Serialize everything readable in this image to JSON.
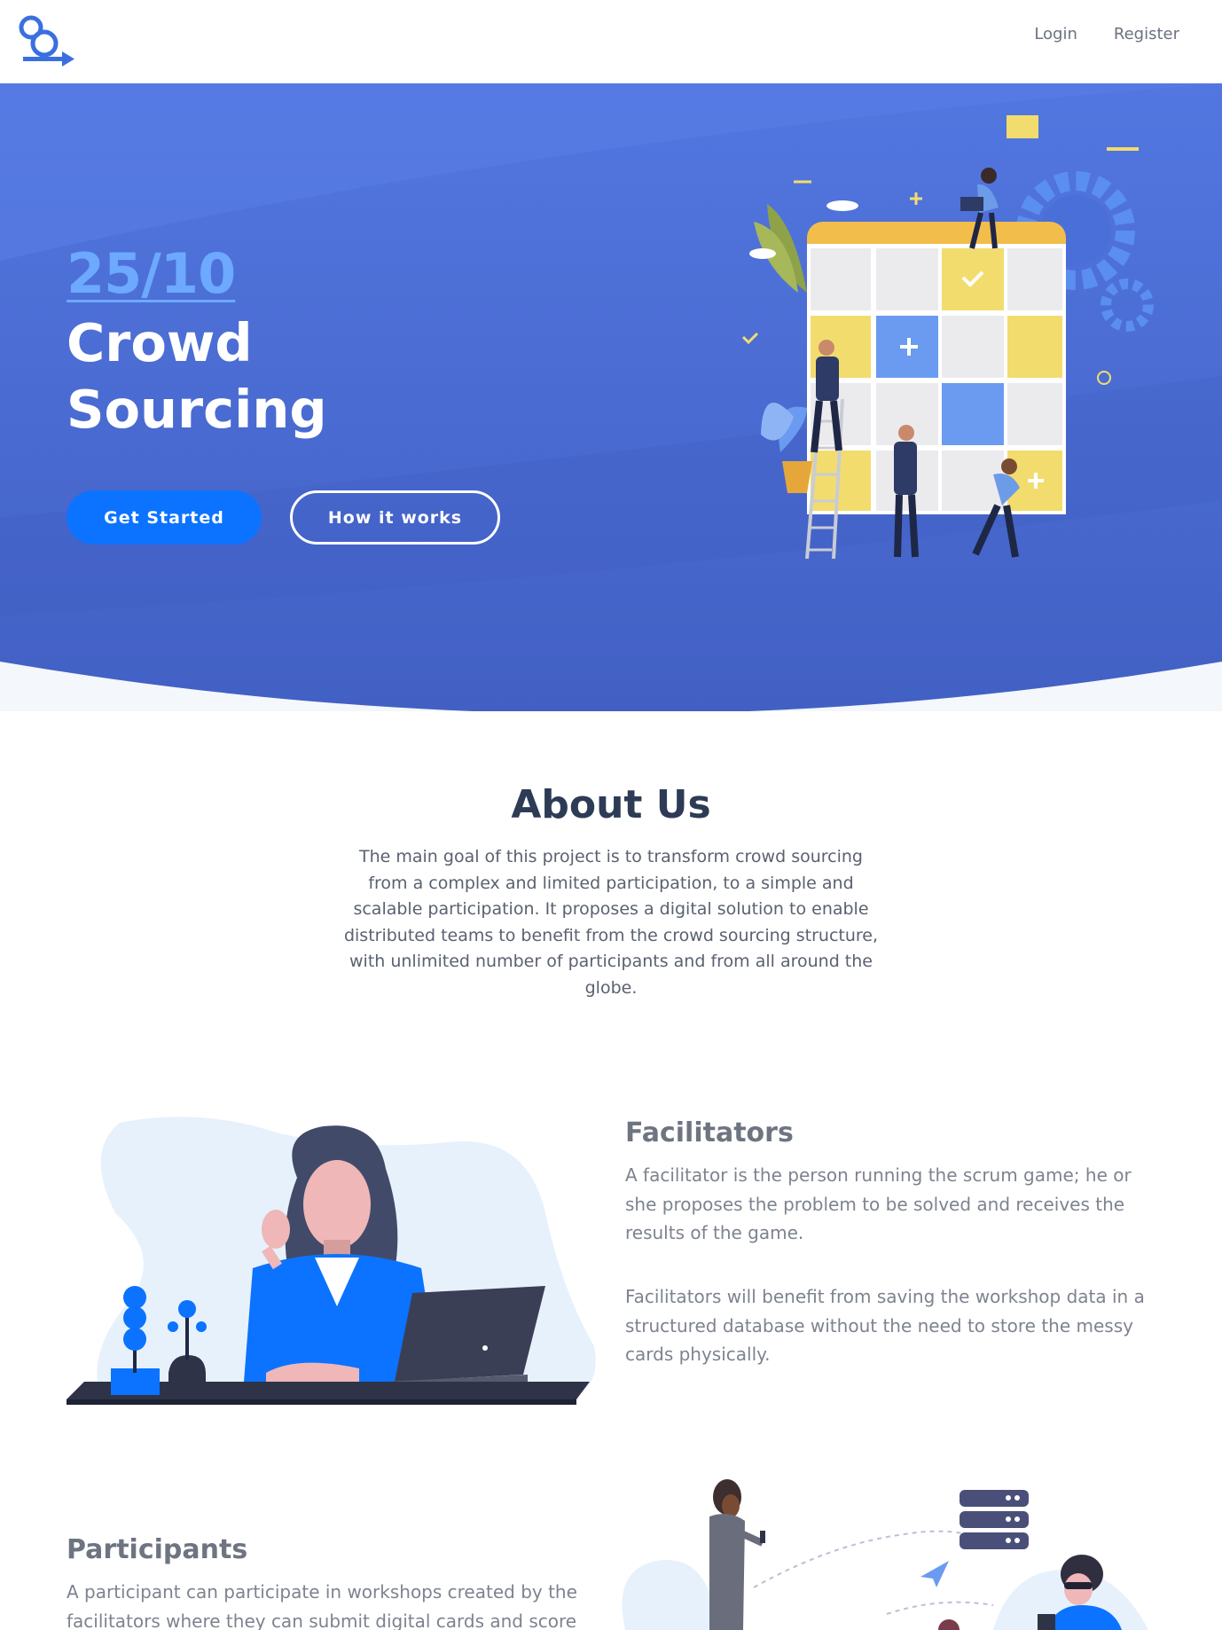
{
  "nav": {
    "login_label": "Login",
    "register_label": "Register"
  },
  "hero": {
    "date": "25/10",
    "title_line1": "Crowd",
    "title_line2": "Sourcing",
    "primary_button": "Get Started",
    "secondary_button": "How it works"
  },
  "about": {
    "title": "About Us",
    "text": "The main goal of this project is to transform crowd sourcing from a complex and limited participation, to a simple and scalable participation. It proposes a digital solution to enable distributed teams to benefit from the crowd sourcing structure, with unlimited number of participants and from all around the globe."
  },
  "facilitators": {
    "title": "Facilitators",
    "paragraph1": "A facilitator is the person running the scrum game; he or she proposes the problem to be solved and receives the results of the game.",
    "paragraph2": "Facilitators will benefit from saving the workshop data in a structured database without the need to store the messy cards physically."
  },
  "participants": {
    "title": "Participants",
    "paragraph1": "A participant can participate in workshops created by the facilitators where they can submit digital cards and score"
  },
  "colors": {
    "brand_blue": "#0b73ff",
    "hero_blue": "#4b6fd9",
    "date_link": "#6ca9ff",
    "heading": "#2e3b55",
    "body_text": "#7d838f"
  },
  "icons": {
    "logo": "logo-icon",
    "hero_illustration": "team-board-illustration",
    "facilitator_illustration": "woman-laptop-illustration",
    "participants_illustration": "people-network-illustration"
  }
}
